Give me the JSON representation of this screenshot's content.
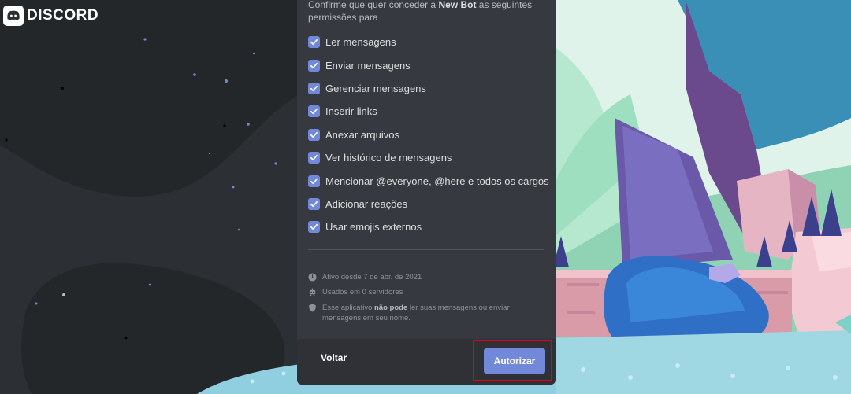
{
  "brand": {
    "logo_text": "DISCORD"
  },
  "auth": {
    "intro_prefix": "Confirme que quer conceder a ",
    "bot_name": "New Bot",
    "intro_suffix": " as seguintes permissões para",
    "permissions": [
      {
        "label": "Ler mensagens",
        "checked": true
      },
      {
        "label": "Enviar mensagens",
        "checked": true
      },
      {
        "label": "Gerenciar mensagens",
        "checked": true
      },
      {
        "label": "Inserir links",
        "checked": true
      },
      {
        "label": "Anexar arquivos",
        "checked": true
      },
      {
        "label": "Ver histórico de mensagens",
        "checked": true
      },
      {
        "label": "Mencionar @everyone, @here e todos os cargos",
        "checked": true
      },
      {
        "label": "Adicionar reações",
        "checked": true
      },
      {
        "label": "Usar emojis externos",
        "checked": true
      }
    ],
    "info": {
      "active_since": "Ativo desde 7 de abr. de 2021",
      "servers_used": "Usados em 0 servidores",
      "privacy_prefix": "Esse aplicativo ",
      "privacy_bold": "não pode",
      "privacy_suffix": " ler suas mensagens ou enviar mensagens em seu nome."
    }
  },
  "footer": {
    "back_label": "Voltar",
    "authorize_label": "Autorizar"
  },
  "colors": {
    "accent": "#7289da",
    "highlight": "#e0001b",
    "modal_bg": "#36393f",
    "footer_bg": "#2f3136"
  },
  "icons": [
    "discord-logo-icon",
    "check-icon",
    "clock-icon",
    "robot-icon",
    "shield-icon"
  ]
}
